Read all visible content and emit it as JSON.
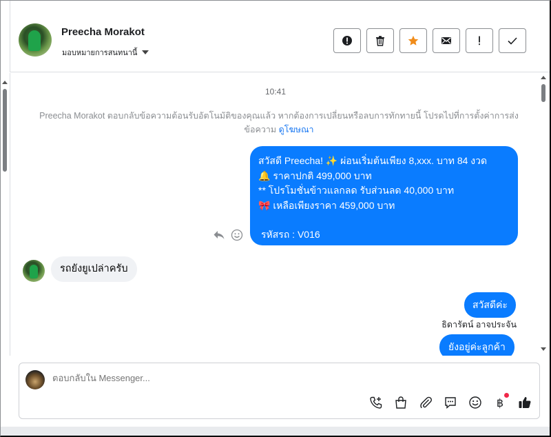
{
  "header": {
    "contact_name": "Preecha Morakot",
    "assign_label": "มอบหมายการสนทนานี้",
    "actions": [
      {
        "icon": "alert-circle-icon"
      },
      {
        "icon": "trash-icon"
      },
      {
        "icon": "star-icon"
      },
      {
        "icon": "mail-icon"
      },
      {
        "icon": "exclamation-icon"
      },
      {
        "icon": "check-icon"
      }
    ]
  },
  "conversation": {
    "timestamp": "10:41",
    "system_message": "Preecha Morakot ตอบกลับข้อความต้อนรับอัตโนมัติของคุณแล้ว หากต้องการเปลี่ยนหรือลบการทักทายนี้ โปรดไปที่การตั้งค่าการส่งข้อความ",
    "system_link": "ดูโฆษณา",
    "outgoing_offer": {
      "lines": [
        "สวัสดี Preecha! ✨  ผ่อนเริ่มต้นเพียง 8,xxx. บาท 84 งวด",
        "🔔 ราคาปกติ 499,000 บาท",
        "** โปรโมชั่นข้าวแลกลด รับส่วนลด 40,000 บาท",
        "🎀  เหลือเพียงราคา 459,000 บาท"
      ],
      "code_line": "รหัสรถ : V016"
    },
    "incoming_message": "รถยังยูเปล่าครับ",
    "outgoing_greeting": "สวัสดีค่ะ",
    "sender_name": "ธิดารัตน์ อาจประจัน",
    "outgoing_reply": "ยังอยู่ค่ะลูกค้า"
  },
  "composer": {
    "placeholder": "ตอบกลับใน Messenger...",
    "tools": [
      "phone-plus-icon",
      "shopping-bag-icon",
      "paperclip-icon",
      "chat-bubble-icon",
      "emoji-icon",
      "baht-icon",
      "thumbs-up-icon"
    ],
    "baht_symbol": "฿"
  },
  "colors": {
    "accent": "#0a7cff",
    "star": "#f08c1a",
    "link": "#1877f2",
    "notification_dot": "#f02849"
  }
}
